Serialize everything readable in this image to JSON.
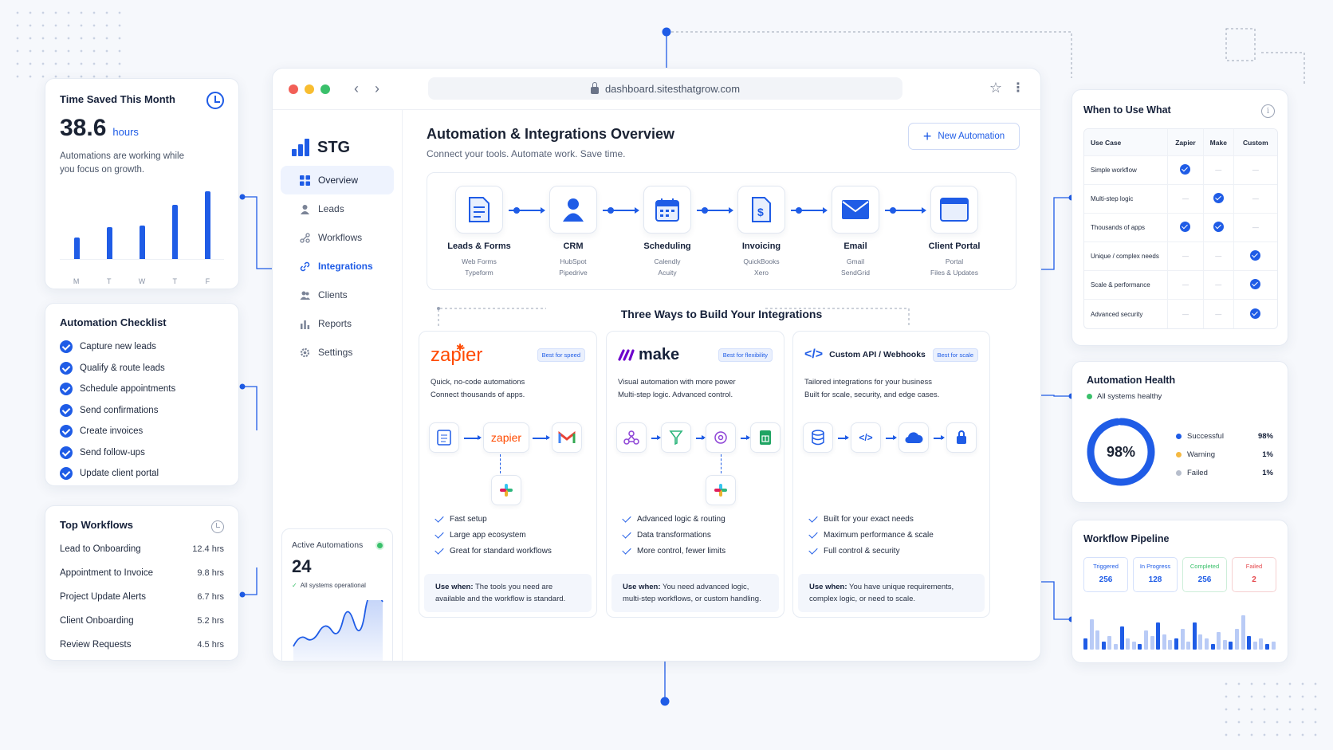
{
  "colors": {
    "accent": "#1f5ce6",
    "success": "#3ac06b",
    "warning": "#f5b942",
    "failed": "#b7becc",
    "danger": "#e5484d"
  },
  "time_saved": {
    "title": "Time Saved This Month",
    "value": "38.6",
    "unit": "hours",
    "description": "Automations are working while you focus on growth.",
    "bars": [
      {
        "label": "M",
        "value": 0.32
      },
      {
        "label": "T",
        "value": 0.47
      },
      {
        "label": "W",
        "value": 0.5
      },
      {
        "label": "T",
        "value": 0.8
      },
      {
        "label": "F",
        "value": 1.0
      }
    ],
    "bar_labels": [
      "M",
      "T",
      "W",
      "T",
      "F"
    ]
  },
  "checklist": {
    "title": "Automation Checklist",
    "items": [
      "Capture new leads",
      "Qualify & route leads",
      "Schedule appointments",
      "Send confirmations",
      "Create invoices",
      "Send follow-ups",
      "Update client portal"
    ]
  },
  "top_workflows": {
    "title": "Top Workflows",
    "rows": [
      {
        "name": "Lead to Onboarding",
        "hours": "12.4 hrs"
      },
      {
        "name": "Appointment to Invoice",
        "hours": "9.8 hrs"
      },
      {
        "name": "Project Update Alerts",
        "hours": "6.7 hrs"
      },
      {
        "name": "Client Onboarding",
        "hours": "5.2 hrs"
      },
      {
        "name": "Review Requests",
        "hours": "4.5 hrs"
      }
    ]
  },
  "browser": {
    "url": "dashboard.sitesthatgrow.com"
  },
  "sidebar": {
    "brand": "STG",
    "items": [
      {
        "label": "Overview",
        "icon": "grid-icon"
      },
      {
        "label": "Leads",
        "icon": "user-icon"
      },
      {
        "label": "Workflows",
        "icon": "workflow-icon"
      },
      {
        "label": "Integrations",
        "icon": "link-icon"
      },
      {
        "label": "Clients",
        "icon": "users-icon"
      },
      {
        "label": "Reports",
        "icon": "chart-icon"
      },
      {
        "label": "Settings",
        "icon": "gear-icon"
      }
    ],
    "active_automations": {
      "label": "Active Automations",
      "value": "24",
      "status": "All systems operational"
    }
  },
  "main": {
    "title": "Automation & Integrations Overview",
    "subtitle": "Connect your tools. Automate work. Save time.",
    "new_button": "New Automation",
    "flow": [
      {
        "title": "Leads & Forms",
        "sub1": "Web Forms",
        "sub2": "Typeform"
      },
      {
        "title": "CRM",
        "sub1": "HubSpot",
        "sub2": "Pipedrive"
      },
      {
        "title": "Scheduling",
        "sub1": "Calendly",
        "sub2": "Acuity"
      },
      {
        "title": "Invoicing",
        "sub1": "QuickBooks",
        "sub2": "Xero"
      },
      {
        "title": "Email",
        "sub1": "Gmail",
        "sub2": "SendGrid"
      },
      {
        "title": "Client Portal",
        "sub1": "Portal",
        "sub2": "Files & Updates"
      }
    ],
    "ways_title": "Three Ways to Build Your Integrations",
    "ways": [
      {
        "name": "zapier",
        "badge": "Best for speed",
        "desc1": "Quick, no-code automations",
        "desc2": "Connect thousands of apps.",
        "features": [
          "Fast setup",
          "Large app ecosystem",
          "Great for standard workflows"
        ],
        "use_when_label": "Use when:",
        "use_when_1": " The tools you need are",
        "use_when_2": "available and the workflow is standard."
      },
      {
        "name": "make",
        "badge": "Best for flexibility",
        "desc1": "Visual automation with more power",
        "desc2": "Multi-step logic. Advanced control.",
        "features": [
          "Advanced logic & routing",
          "Data transformations",
          "More control, fewer limits"
        ],
        "use_when_label": "Use when:",
        "use_when_1": " You need advanced logic,",
        "use_when_2": "multi-step workflows, or custom handling."
      },
      {
        "name": "Custom API / Webhooks",
        "badge": "Best for scale",
        "desc1": "Tailored integrations for your business",
        "desc2": "Built for scale, security, and edge cases.",
        "features": [
          "Built for your exact needs",
          "Maximum performance & scale",
          "Full control & security"
        ],
        "use_when_label": "Use when:",
        "use_when_1": " You have unique requirements,",
        "use_when_2": "complex logic, or need to scale."
      }
    ],
    "zapier_chip": "zapier"
  },
  "when_to_use": {
    "title": "When to Use What",
    "columns": [
      "Use Case",
      "Zapier",
      "Make",
      "Custom"
    ],
    "rows": [
      {
        "case": "Simple workflow",
        "marks": [
          true,
          false,
          false
        ]
      },
      {
        "case": "Multi-step logic",
        "marks": [
          false,
          true,
          false
        ]
      },
      {
        "case": "Thousands of apps",
        "marks": [
          true,
          true,
          false
        ]
      },
      {
        "case": "Unique / complex needs",
        "marks": [
          false,
          false,
          true
        ]
      },
      {
        "case": "Scale & performance",
        "marks": [
          false,
          false,
          true
        ]
      },
      {
        "case": "Advanced security",
        "marks": [
          false,
          false,
          true
        ]
      }
    ],
    "dash": "—"
  },
  "health": {
    "title": "Automation Health",
    "status": "All systems healthy",
    "percent": "98%",
    "percent_value": 0.98,
    "legend": [
      {
        "label": "Successful",
        "value": "98%",
        "color": "#1f5ce6"
      },
      {
        "label": "Warning",
        "value": "1%",
        "color": "#f5b942"
      },
      {
        "label": "Failed",
        "value": "1%",
        "color": "#b7becc"
      }
    ]
  },
  "pipeline": {
    "title": "Workflow Pipeline",
    "stages": [
      {
        "label": "Triggered",
        "value": "256",
        "color": "#1f5ce6"
      },
      {
        "label": "In Progress",
        "value": "128",
        "color": "#1f5ce6"
      },
      {
        "label": "Completed",
        "value": "256",
        "color": "#3ac06b"
      },
      {
        "label": "Failed",
        "value": "2",
        "color": "#e5484d"
      }
    ]
  }
}
